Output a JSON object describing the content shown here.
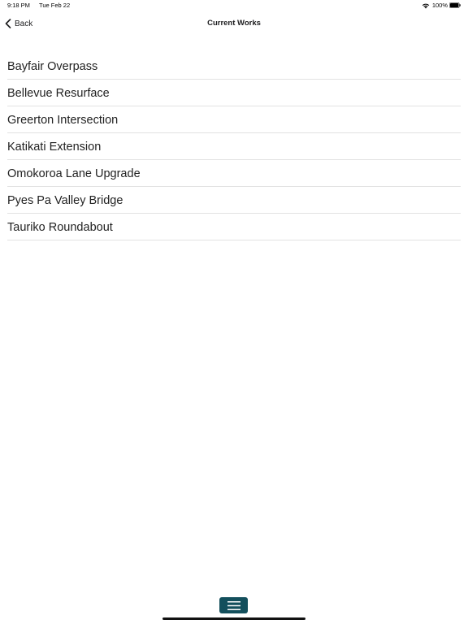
{
  "status_bar": {
    "time": "9:18 PM",
    "date": "Tue Feb 22",
    "battery": "100%",
    "wifi_icon": "wifi-icon",
    "battery_icon": "battery-full-icon"
  },
  "nav": {
    "back_label": "Back",
    "back_icon": "chevron-left-icon",
    "title": "Current Works"
  },
  "works": [
    {
      "label": "Bayfair Overpass"
    },
    {
      "label": "Bellevue Resurface"
    },
    {
      "label": "Greerton Intersection"
    },
    {
      "label": "Katikati Extension"
    },
    {
      "label": "Omokoroa Lane Upgrade"
    },
    {
      "label": "Pyes Pa Valley Bridge"
    },
    {
      "label": "Tauriko Roundabout"
    }
  ],
  "bottom_bar": {
    "menu_icon": "hamburger-menu-icon",
    "menu_button_color": "#134f5c"
  }
}
